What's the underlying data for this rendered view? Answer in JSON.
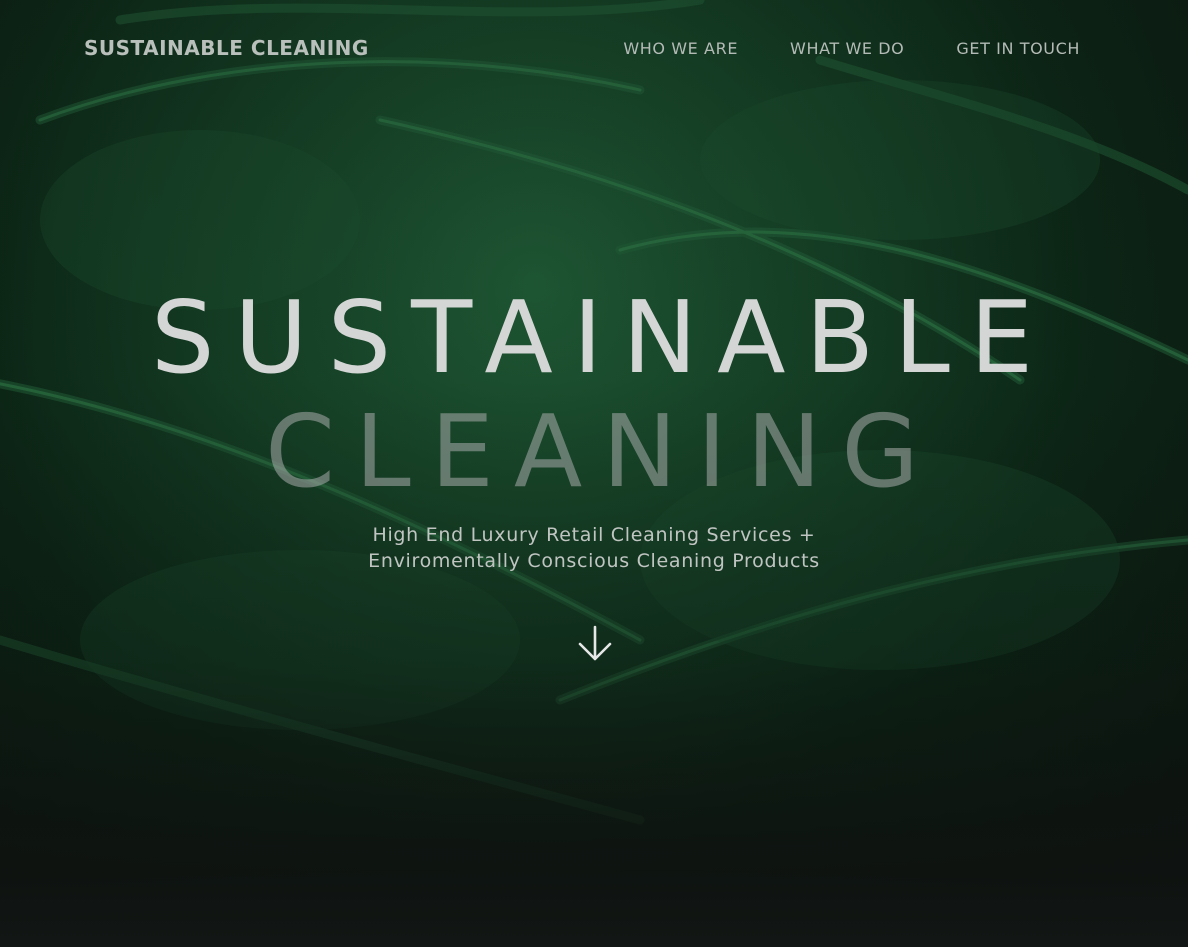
{
  "header": {
    "brand": "SUSTAINABLE CLEANING",
    "nav": [
      {
        "label": "WHO WE ARE"
      },
      {
        "label": "WHAT WE DO"
      },
      {
        "label": "GET IN TOUCH"
      }
    ]
  },
  "hero": {
    "title_line1": "SUSTAINABLE",
    "title_line2": "CLEANING",
    "subtitle_line1": "High End Luxury Retail Cleaning Services +",
    "subtitle_line2": "Enviromentally Conscious Cleaning Products",
    "scroll_icon": "arrow-down-icon"
  },
  "colors": {
    "background": "#0c2616",
    "fern": "#1e5a34",
    "text": "#d4d6d5"
  }
}
